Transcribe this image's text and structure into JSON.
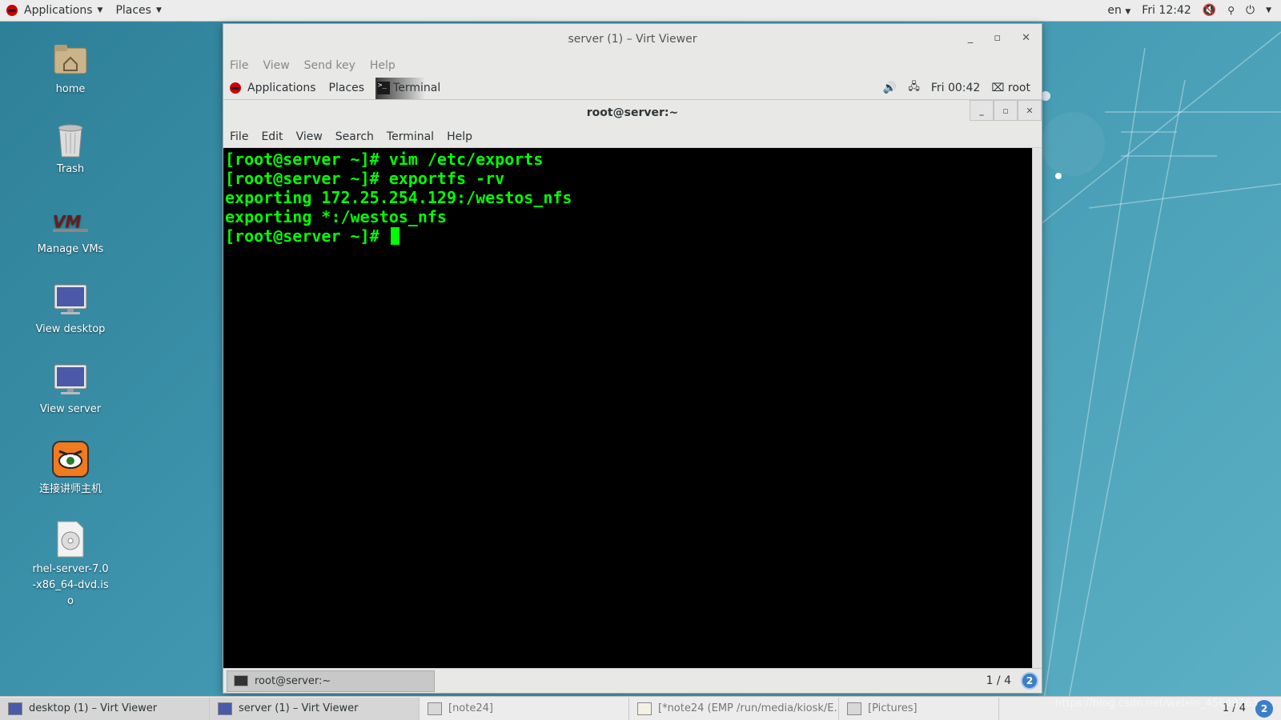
{
  "host_topbar": {
    "applications": "Applications",
    "places": "Places",
    "lang": "en",
    "clock": "Fri 12:42"
  },
  "desktop_icons": [
    {
      "label": "home",
      "icon": "folder-home-icon"
    },
    {
      "label": "Trash",
      "icon": "trash-icon"
    },
    {
      "label": "Manage VMs",
      "icon": "virt-manager-icon"
    },
    {
      "label": "View desktop",
      "icon": "monitor-icon"
    },
    {
      "label": "View server",
      "icon": "monitor-icon"
    },
    {
      "label": "连接讲师主机",
      "icon": "remote-connect-icon"
    },
    {
      "label": "rhel-server-7.0-x86_64-dvd.iso",
      "icon": "disc-image-icon"
    }
  ],
  "virt_viewer": {
    "title": "server (1) – Virt Viewer",
    "menu": [
      "File",
      "View",
      "Send key",
      "Help"
    ]
  },
  "guest_topbar": {
    "applications": "Applications",
    "places": "Places",
    "terminal": "Terminal",
    "clock": "Fri 00:42",
    "user": "root"
  },
  "terminal": {
    "title": "root@server:~",
    "menu": [
      "File",
      "Edit",
      "View",
      "Search",
      "Terminal",
      "Help"
    ],
    "lines": [
      "[root@server ~]# vim /etc/exports",
      "[root@server ~]# exportfs -rv",
      "exporting 172.25.254.129:/westos_nfs",
      "exporting *:/westos_nfs",
      "[root@server ~]# "
    ],
    "text_color": "#00ff00"
  },
  "guest_bottombar": {
    "task": "root@server:~",
    "pager": "1 / 4",
    "badge": "2"
  },
  "taskbar": {
    "tasks": [
      "desktop (1) – Virt Viewer",
      "server (1) – Virt Viewer",
      "[note24]",
      "[*note24 (EMP /run/media/kiosk/E...",
      "[Pictures]"
    ],
    "pager": "1 / 4",
    "badge": "2"
  },
  "watermark": "https://blog.csdn.net/weixin_45649763"
}
